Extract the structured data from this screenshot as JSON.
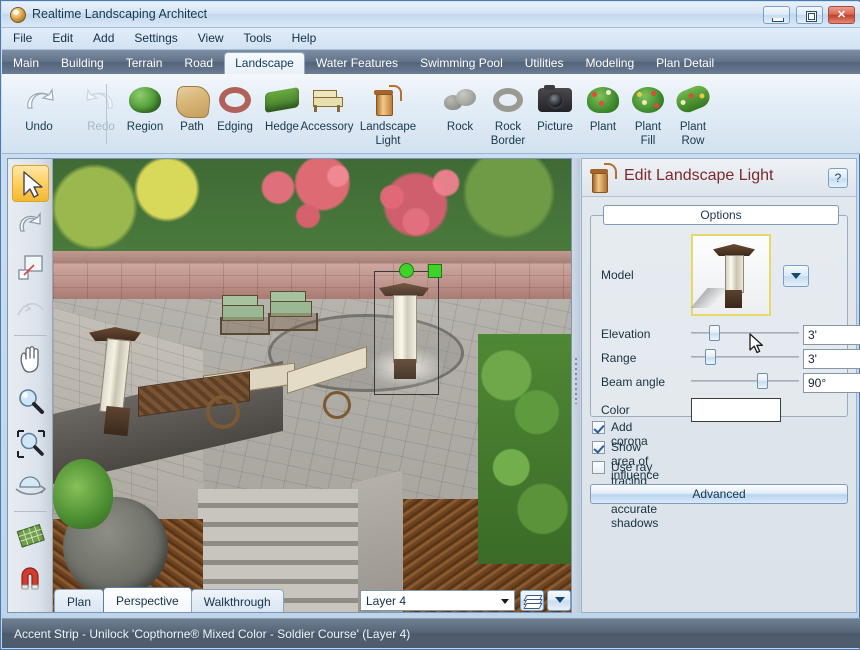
{
  "window": {
    "title": "Realtime Landscaping Architect",
    "app_icon": "globe-icon",
    "minimize_label": "Minimize",
    "maximize_label": "Maximize",
    "close_label": "Close"
  },
  "menubar": {
    "items": [
      {
        "label": "File"
      },
      {
        "label": "Edit"
      },
      {
        "label": "Add"
      },
      {
        "label": "Settings"
      },
      {
        "label": "View"
      },
      {
        "label": "Tools"
      },
      {
        "label": "Help"
      }
    ]
  },
  "ribbon_tabs": {
    "active": "Landscape",
    "items": [
      {
        "label": "Main"
      },
      {
        "label": "Building"
      },
      {
        "label": "Terrain"
      },
      {
        "label": "Road"
      },
      {
        "label": "Landscape"
      },
      {
        "label": "Water Features"
      },
      {
        "label": "Swimming Pool"
      },
      {
        "label": "Utilities"
      },
      {
        "label": "Modeling"
      },
      {
        "label": "Plan Detail"
      }
    ]
  },
  "toolbar": {
    "items": [
      {
        "label": "Undo",
        "icon": "undo-arrow-icon",
        "disabled": false
      },
      {
        "label": "Redo",
        "icon": "redo-arrow-icon",
        "disabled": true
      },
      {
        "label": "Region",
        "icon": "shrub-region-icon",
        "disabled": false
      },
      {
        "label": "Path",
        "icon": "path-icon",
        "disabled": false
      },
      {
        "label": "Edging",
        "icon": "edging-ring-icon",
        "disabled": false
      },
      {
        "label": "Hedge",
        "icon": "hedge-icon",
        "disabled": false
      },
      {
        "label": "Accessory",
        "icon": "patio-chair-icon",
        "disabled": false
      },
      {
        "label": "Landscape\nLight",
        "label_line1": "Landscape",
        "label_line2": "Light",
        "icon": "lantern-icon",
        "disabled": false
      },
      {
        "label": "Rock",
        "icon": "rock-icon",
        "disabled": false
      },
      {
        "label": "Rock\nBorder",
        "label_line1": "Rock",
        "label_line2": "Border",
        "icon": "rock-border-icon",
        "disabled": false
      },
      {
        "label": "Picture",
        "icon": "camera-icon",
        "disabled": false
      },
      {
        "label": "Plant",
        "icon": "plant-icon",
        "disabled": false
      },
      {
        "label": "Plant\nFill",
        "label_line1": "Plant",
        "label_line2": "Fill",
        "icon": "plant-fill-icon",
        "disabled": false
      },
      {
        "label": "Plant\nRow",
        "label_line1": "Plant",
        "label_line2": "Row",
        "icon": "plant-row-icon",
        "disabled": false
      }
    ]
  },
  "viewport_tools": {
    "items": [
      {
        "name": "select-arrow-tool",
        "selected": true
      },
      {
        "name": "rotate-tool",
        "selected": false
      },
      {
        "name": "resize-tool",
        "selected": false
      },
      {
        "name": "curve-tool",
        "selected": false,
        "disabled": true
      },
      {
        "name": "pan-hand-tool",
        "selected": false
      },
      {
        "name": "zoom-tool",
        "selected": false
      },
      {
        "name": "zoom-window-tool",
        "selected": false
      },
      {
        "name": "orbit-tool",
        "selected": false
      },
      {
        "name": "grid-tool",
        "selected": false
      },
      {
        "name": "magnet-snap-tool",
        "selected": false
      }
    ]
  },
  "view_tabs": {
    "active": "Perspective",
    "items": [
      {
        "label": "Plan"
      },
      {
        "label": "Perspective"
      },
      {
        "label": "Walkthrough"
      }
    ]
  },
  "layer_bar": {
    "selected_layer": "Layer 4",
    "layers_button": "layers-stack-icon",
    "dropdown_button": "chevron-down-icon"
  },
  "panel": {
    "icon": "lantern-icon",
    "title": "Edit Landscape Light",
    "help_label": "?",
    "group_title": "Options",
    "model": {
      "label": "Model",
      "thumbnail": "bollard-light-thumbnail",
      "dropdown": "chevron-down-icon"
    },
    "fields": [
      {
        "label": "Elevation",
        "value": "3'",
        "slider_percent": 18
      },
      {
        "label": "Range",
        "value": "3'",
        "slider_percent": 14
      },
      {
        "label": "Beam angle",
        "value": "90°",
        "slider_percent": 62
      }
    ],
    "color": {
      "label": "Color",
      "swatch": "#ffffff"
    },
    "checkboxes": [
      {
        "label": "Add corona",
        "checked": true
      },
      {
        "label": "Show area of influence",
        "checked": true
      },
      {
        "label": "Use ray tracing for accurate shadows",
        "checked": false
      }
    ],
    "advanced_label": "Advanced"
  },
  "statusbar": {
    "text": "Accent Strip - Unilock 'Copthorne® Mixed Color - Soldier Course' (Layer 4)"
  },
  "colors": {
    "title_accent": "#7d2a2a",
    "tabbar_bg": "#62738a",
    "statusbar_bg": "#56657a",
    "selection_handle": "#3fd22a",
    "selected_tool_highlight": "#ffcf60"
  }
}
